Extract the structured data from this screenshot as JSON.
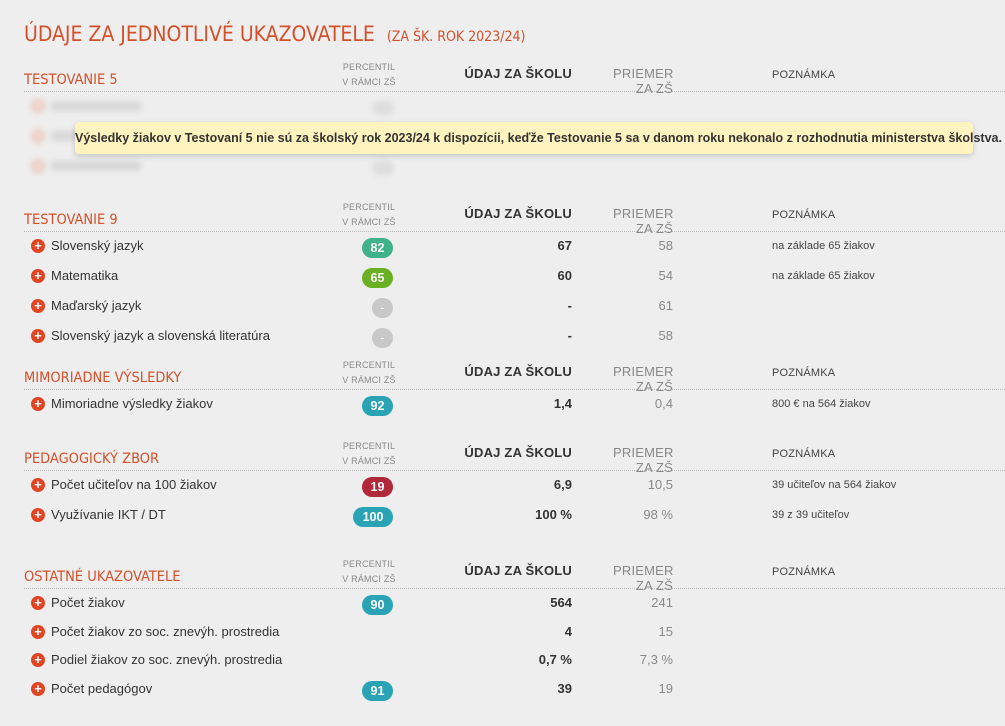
{
  "page": {
    "title": "ÚDAJE ZA JEDNOTLIVÉ UKAZOVATELE",
    "subtitle": "(ZA ŠK. ROK 2023/24)"
  },
  "columns": {
    "percentile_1": "PERCENTIL",
    "percentile_2": "V RÁMCI ZŠ",
    "school": "ÚDAJ ZA ŠKOLU",
    "avg_1": "PRIEMER",
    "avg_2": "ZA ZŠ",
    "note": "POZNÁMKA"
  },
  "colors": {
    "accent": "#d4502a",
    "teal": "#2aa3b5",
    "green": "#3fb28a",
    "lime": "#6ab023",
    "red": "#b1283b",
    "na": "#c8c8c8"
  },
  "testovanie5": {
    "title": "TESTOVANIE 5",
    "notice": "Výsledky žiakov v Testovaní 5 nie sú za školský rok 2023/24 k dispozícii, keďže Testovanie 5 sa v danom roku nekonalo z rozhodnutia ministerstva školstva."
  },
  "testovanie9": {
    "title": "TESTOVANIE 9",
    "rows": [
      {
        "label": "Slovenský jazyk",
        "percentile": "82",
        "school": "67",
        "avg": "58",
        "note": "na základe 65 žiakov"
      },
      {
        "label": "Matematika",
        "percentile": "65",
        "school": "60",
        "avg": "54",
        "note": "na základe 65 žiakov"
      },
      {
        "label": "Maďarský jazyk",
        "percentile": "-",
        "school": "-",
        "avg": "61",
        "note": ""
      },
      {
        "label": "Slovenský jazyk a slovenská literatúra",
        "percentile": "-",
        "school": "-",
        "avg": "58",
        "note": ""
      }
    ]
  },
  "mimoriadne": {
    "title": "MIMORIADNE VÝSLEDKY",
    "rows": [
      {
        "label": "Mimoriadne výsledky žiakov",
        "percentile": "92",
        "school": "1,4",
        "avg": "0,4",
        "note": "800 € na 564 žiakov"
      }
    ]
  },
  "zbor": {
    "title": "PEDAGOGICKÝ ZBOR",
    "rows": [
      {
        "label": "Počet učiteľov na 100 žiakov",
        "percentile": "19",
        "school": "6,9",
        "avg": "10,5",
        "note": "39 učiteľov na 564 žiakov"
      },
      {
        "label": "Využívanie IKT / DT",
        "percentile": "100",
        "school": "100 %",
        "avg": "98 %",
        "note": "39 z 39 učiteľov"
      }
    ]
  },
  "ostatne": {
    "title": "OSTATNÉ UKAZOVATELE",
    "rows": [
      {
        "label": "Počet žiakov",
        "percentile": "90",
        "school": "564",
        "avg": "241",
        "note": ""
      },
      {
        "label": "Počet žiakov zo soc. znevýh. prostredia",
        "percentile": "",
        "school": "4",
        "avg": "15",
        "note": ""
      },
      {
        "label": "Podiel žiakov zo soc. znevýh. prostredia",
        "percentile": "",
        "school": "0,7 %",
        "avg": "7,3 %",
        "note": ""
      },
      {
        "label": "Počet pedagógov",
        "percentile": "91",
        "school": "39",
        "avg": "19",
        "note": ""
      }
    ]
  }
}
